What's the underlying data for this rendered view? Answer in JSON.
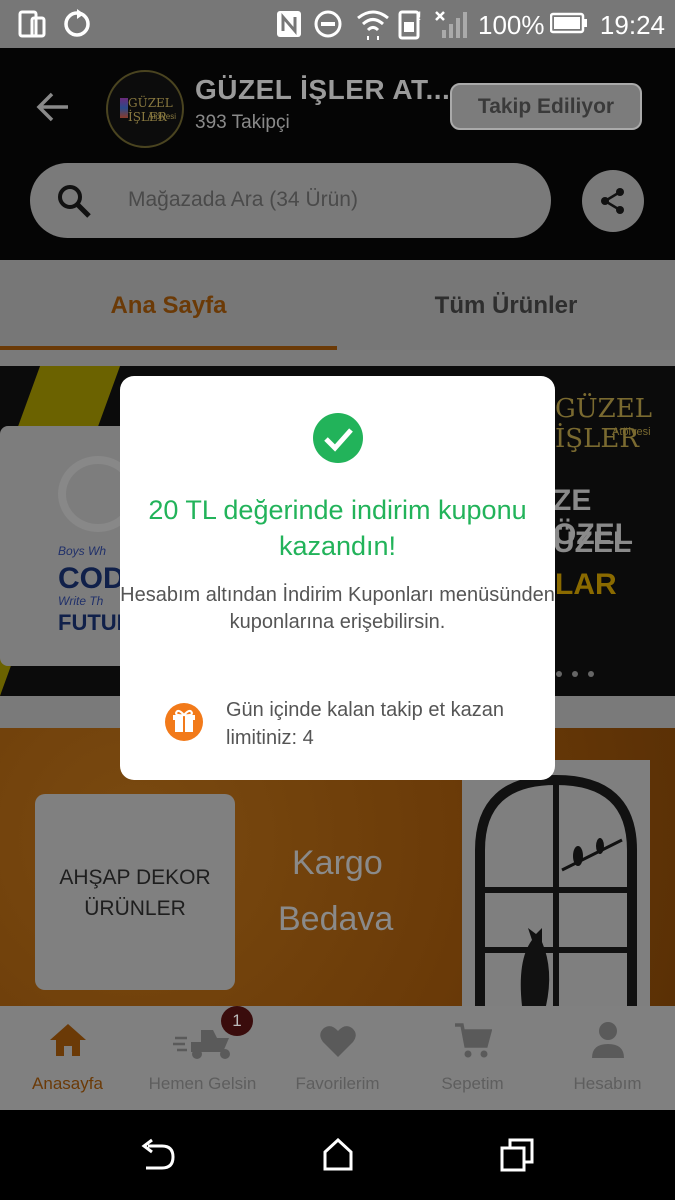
{
  "status_bar": {
    "battery_percent": "100%",
    "time": "19:24"
  },
  "header": {
    "store_name": "GÜZEL İŞLER AT...",
    "followers": "393 Takipçi",
    "follow_button": "Takip Ediliyor",
    "search_placeholder": "Mağazada Ara (34 Ürün)",
    "logo_text": "GÜZEL İŞLER",
    "logo_subtext": "Atölyesi"
  },
  "tabs": [
    {
      "label": "Ana Sayfa",
      "active": true
    },
    {
      "label": "Tüm Ürünler",
      "active": false
    }
  ],
  "banner1": {
    "brand": "GÜZEL İŞLER",
    "brand_sub": "Atölyesi",
    "mug_lines": [
      "Boys Wh",
      "CODE",
      "Write Th",
      "FUTUR"
    ],
    "right_lines": [
      "ZE ÖZEL",
      "ÜZEL",
      "LAR"
    ]
  },
  "banner2": {
    "box_lines": [
      "AHŞAP DEKOR",
      "ÜRÜNLER"
    ],
    "promo_lines": [
      "Kargo",
      "Bedava"
    ]
  },
  "dialog": {
    "title": "20 TL değerinde indirim kuponu kazandın!",
    "body": "Hesabım altından İndirim Kuponları menüsünden kuponlarına erişebilirsin.",
    "limit_text": "Gün içinde kalan takip et kazan limitiniz: 4"
  },
  "bottom_nav": [
    {
      "label": "Anasayfa",
      "icon": "home-icon",
      "active": true
    },
    {
      "label": "Hemen Gelsin",
      "icon": "scooter-icon",
      "badge": "1"
    },
    {
      "label": "Favorilerim",
      "icon": "heart-icon"
    },
    {
      "label": "Sepetim",
      "icon": "cart-icon"
    },
    {
      "label": "Hesabım",
      "icon": "person-icon"
    }
  ],
  "colors": {
    "accent": "#f27a1a",
    "success": "#22b35a",
    "badge": "#8b1a1a"
  }
}
